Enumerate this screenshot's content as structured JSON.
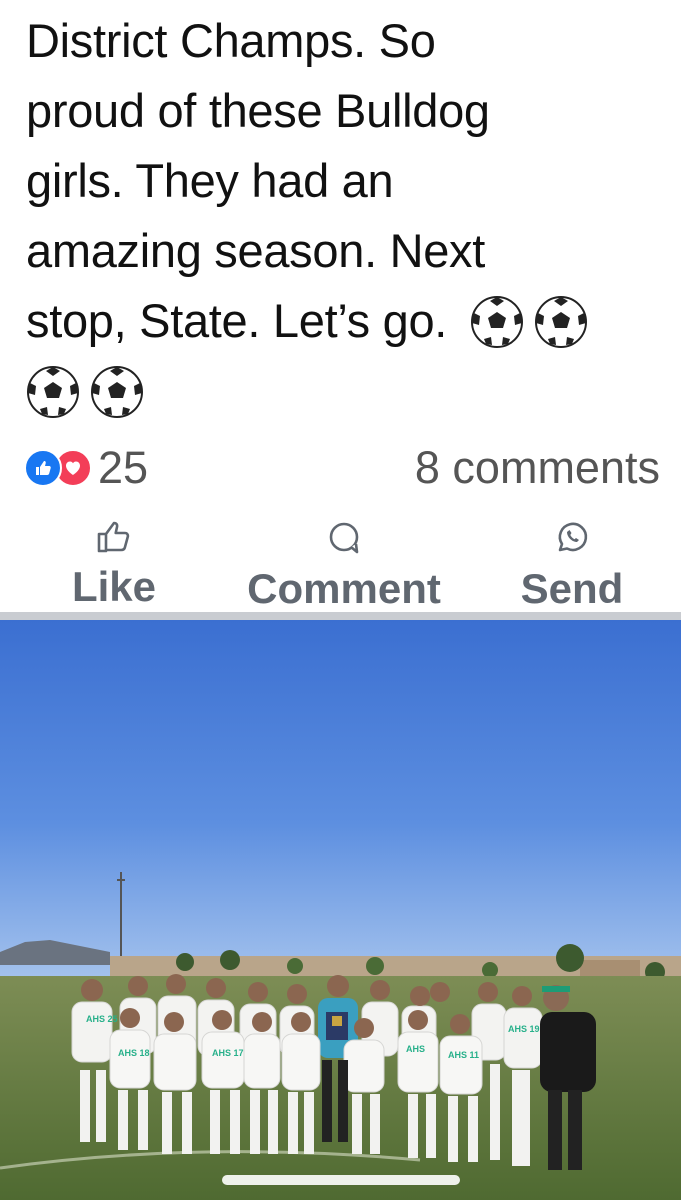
{
  "post": {
    "text_lines": [
      "District Champs. So",
      "proud of these Bulldog",
      "girls. They had an",
      "amazing season. Next",
      "stop, State. Let’s go."
    ],
    "emojis": [
      "soccer-ball",
      "soccer-ball",
      "soccer-ball",
      "soccer-ball"
    ]
  },
  "stats": {
    "reaction_icons": [
      "like-icon",
      "love-icon"
    ],
    "reaction_count": "25",
    "comments": "8 comments"
  },
  "actions": {
    "like": "Like",
    "comment": "Comment",
    "send": "Send"
  },
  "photo": {
    "jerseys": [
      "AHS 25",
      "AHS 18",
      "AHS 17",
      "AHS 11",
      "AHS 19",
      "AHS"
    ]
  },
  "colors": {
    "like_blue": "#1877f2",
    "love_red": "#f33e58",
    "sky": "#3d74d6",
    "grass": "#5e7a3a",
    "jersey_accent": "#27b08a"
  }
}
